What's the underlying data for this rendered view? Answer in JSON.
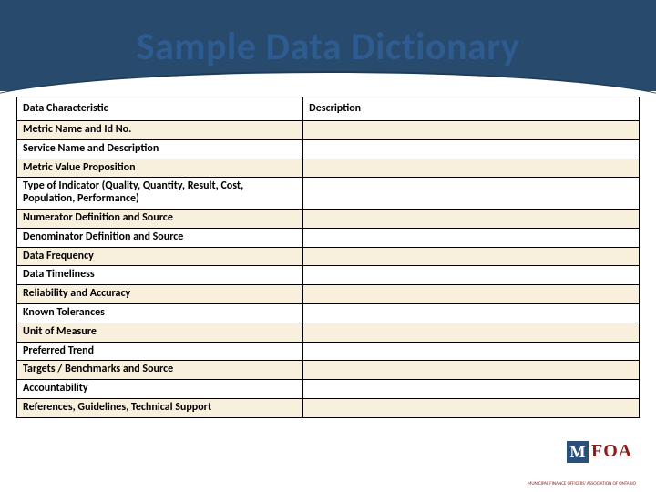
{
  "title": "Sample Data Dictionary",
  "headers": {
    "left": "Data Characteristic",
    "right": "Description"
  },
  "rows": [
    {
      "label": "Metric Name and Id No.",
      "desc": ""
    },
    {
      "label": "Service Name and Description",
      "desc": ""
    },
    {
      "label": "Metric Value Proposition",
      "desc": ""
    },
    {
      "label": "Type of Indicator (Quality, Quantity, Result, Cost, Population, Performance)",
      "desc": ""
    },
    {
      "label": "Numerator Definition and Source",
      "desc": ""
    },
    {
      "label": "Denominator Definition and Source",
      "desc": ""
    },
    {
      "label": "Data Frequency",
      "desc": ""
    },
    {
      "label": "Data Timeliness",
      "desc": ""
    },
    {
      "label": "Reliability and Accuracy",
      "desc": ""
    },
    {
      "label": "Known Tolerances",
      "desc": ""
    },
    {
      "label": "Unit of Measure",
      "desc": ""
    },
    {
      "label": "Preferred Trend",
      "desc": ""
    },
    {
      "label": "Targets / Benchmarks and Source",
      "desc": ""
    },
    {
      "label": "Accountability",
      "desc": ""
    },
    {
      "label": "References, Guidelines, Technical Support",
      "desc": ""
    }
  ],
  "logo": {
    "m": "M",
    "foa": "FOA",
    "sub": "MUNICIPAL FINANCE OFFICERS' ASSOCIATION OF ONTARIO"
  }
}
